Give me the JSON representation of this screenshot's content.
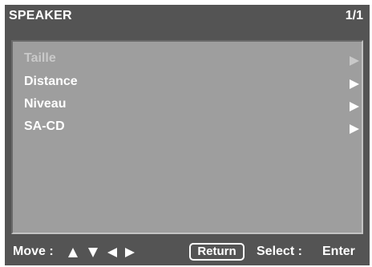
{
  "header": {
    "title": "SPEAKER",
    "page": "1/1"
  },
  "menu": {
    "items": [
      {
        "label": "Taille",
        "enabled": false,
        "arrow": "right-triangle-icon"
      },
      {
        "label": "Distance",
        "enabled": true,
        "arrow": "right-triangle-icon"
      },
      {
        "label": "Niveau",
        "enabled": true,
        "arrow": "right-triangle-icon"
      },
      {
        "label": "SA-CD",
        "enabled": true,
        "arrow": "right-triangle-icon"
      }
    ]
  },
  "footer": {
    "move_label": "Move :",
    "move_icons": [
      "up-triangle-icon",
      "down-triangle-icon",
      "left-triangle-icon",
      "right-triangle-icon"
    ],
    "return_label": "Return",
    "select_label": "Select :",
    "enter_label": "Enter"
  },
  "colors": {
    "background": "#545454",
    "panel": "#9e9e9e",
    "text": "#ffffff",
    "disabled_text": "#c9c9c9"
  }
}
